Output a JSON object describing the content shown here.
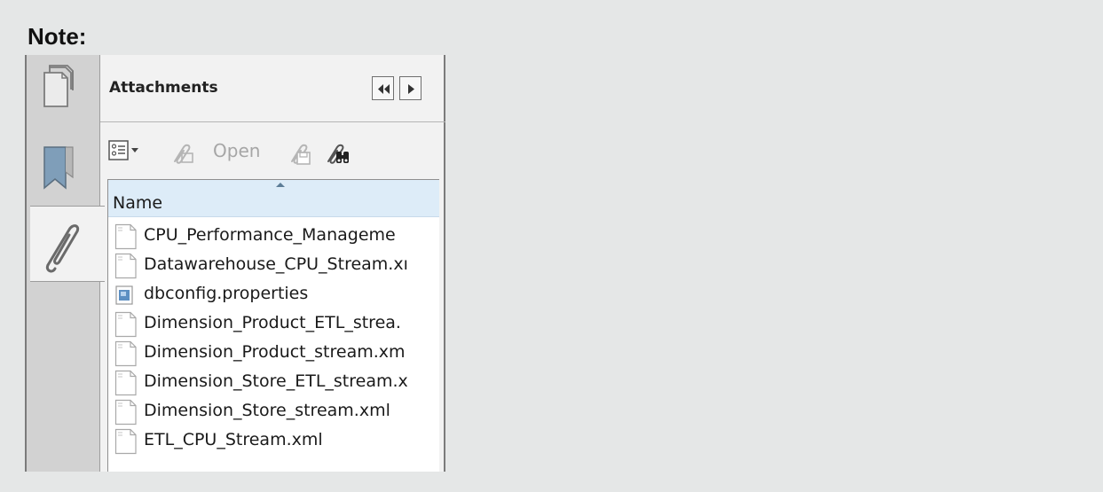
{
  "note": {
    "title": "Note:"
  },
  "side_tabs": [
    {
      "name": "Pages",
      "icon": "pages-icon",
      "active": false
    },
    {
      "name": "Bookmarks",
      "icon": "bookmark-icon",
      "active": false
    },
    {
      "name": "Attachments",
      "icon": "paperclip-icon",
      "active": true
    }
  ],
  "panel": {
    "title": "Attachments",
    "nav_buttons": [
      {
        "icon": "collapse-left-icon"
      },
      {
        "icon": "expand-right-icon"
      }
    ]
  },
  "toolbar": {
    "options_icon": "options-menu-icon",
    "open_label": "Open",
    "open_enabled": false,
    "save_icon": "save-attachment-icon",
    "search_icon": "binoculars-icon"
  },
  "file_list": {
    "column_header": "Name",
    "sort": "ascending",
    "files": [
      {
        "name": "CPU_Performance_Manageme",
        "type": "text"
      },
      {
        "name": "Datawarehouse_CPU_Stream.xı",
        "type": "text"
      },
      {
        "name": "dbconfig.properties",
        "type": "properties"
      },
      {
        "name": "Dimension_Product_ETL_strea.",
        "type": "text"
      },
      {
        "name": "Dimension_Product_stream.xm",
        "type": "text"
      },
      {
        "name": "Dimension_Store_ETL_stream.x",
        "type": "text"
      },
      {
        "name": "Dimension_Store_stream.xml",
        "type": "text"
      },
      {
        "name": "ETL_CPU_Stream.xml",
        "type": "text"
      }
    ]
  },
  "colors": {
    "background": "#e5e7e7",
    "tab_rail": "#d2d2d2",
    "panel_bg": "#f2f2f2",
    "column_header_bg": "#ddecf8",
    "disabled_text": "#a6a6a6"
  }
}
